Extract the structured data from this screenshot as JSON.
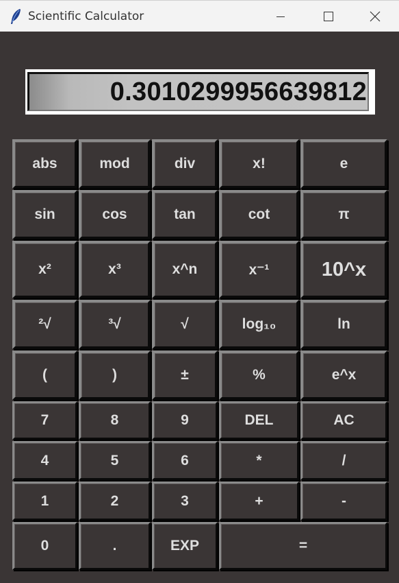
{
  "window": {
    "title": "Scientific Calculator",
    "icon": "feather-icon",
    "controls": [
      "minimize-icon",
      "maximize-icon",
      "close-icon"
    ]
  },
  "display": {
    "value": "0.3010299956639812"
  },
  "keys": {
    "abs": "abs",
    "mod": "mod",
    "div": "div",
    "factorial": "x!",
    "e": "e",
    "sin": "sin",
    "cos": "cos",
    "tan": "tan",
    "cot": "cot",
    "pi": "π",
    "square": "x²",
    "cube": "x³",
    "power": "x^n",
    "inverse": "x⁻¹",
    "pow10": "10^x",
    "sqrt2": "²√",
    "cbrt": "³√",
    "sqrt": "√",
    "log10": "log₁₀",
    "ln": "ln",
    "lparen": "(",
    "rparen": ")",
    "plusminus": "±",
    "percent": "%",
    "exp_e": "e^x",
    "7": "7",
    "8": "8",
    "9": "9",
    "del": "DEL",
    "ac": "AC",
    "4": "4",
    "5": "5",
    "6": "6",
    "mul": "*",
    "divide": "/",
    "1": "1",
    "2": "2",
    "3": "3",
    "plus": "+",
    "minus": "-",
    "0": "0",
    "dot": ".",
    "exp": "EXP",
    "equals": "="
  },
  "colors": {
    "background": "#3a3535",
    "key_text": "#dedede",
    "display_bg": "#c4c4c4"
  }
}
